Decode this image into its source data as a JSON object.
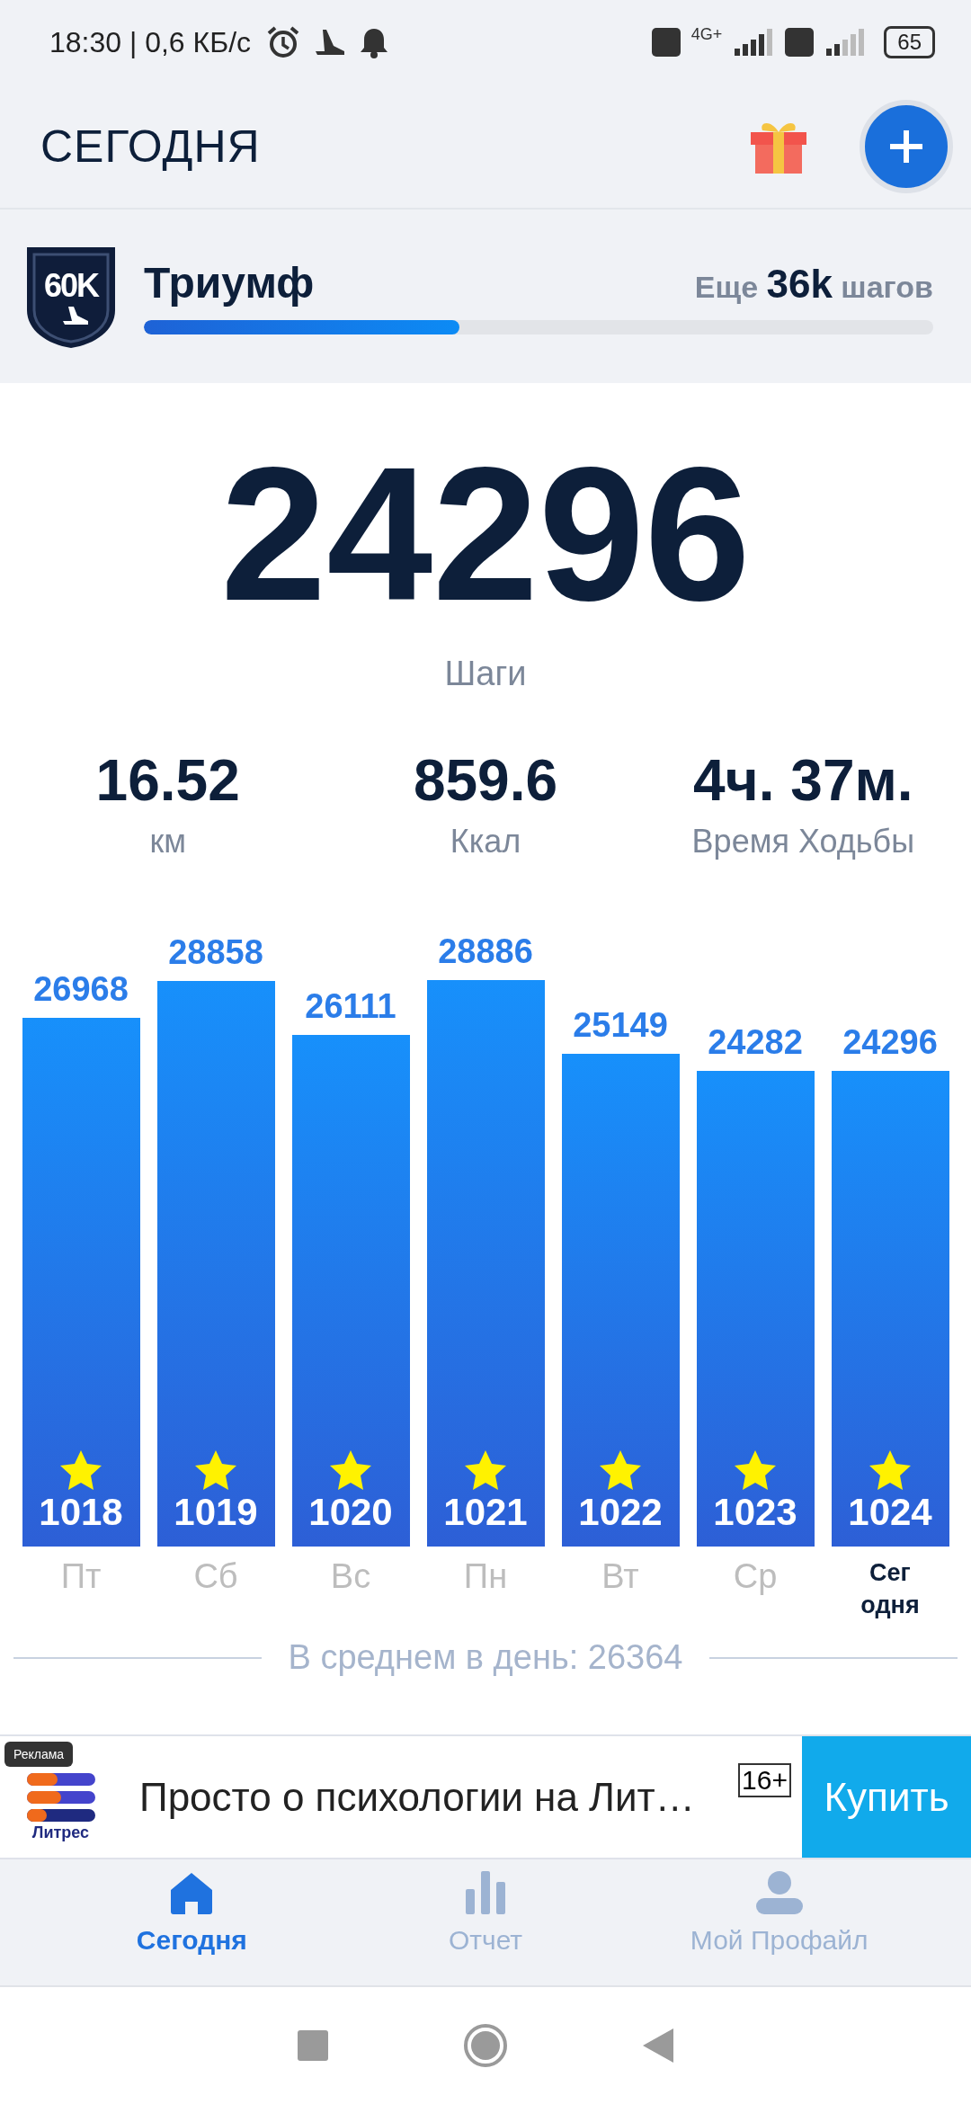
{
  "status_bar": {
    "time": "18:30 | 0,6 КБ/с",
    "network": "4G+",
    "battery": "65"
  },
  "header": {
    "title": "СЕГОДНЯ"
  },
  "goal": {
    "badge": "60K",
    "name": "Триумф",
    "remaining": "Еще **36k** шагов",
    "level": 0.4
  },
  "steps": {
    "value": "24296",
    "label": "Шаги"
  },
  "stats": [
    {
      "value": "16.52",
      "label": "км"
    },
    {
      "value": "859.6",
      "label": "Ккал"
    },
    {
      "value": "4ч. 37м.",
      "label": "Время Ходьбы"
    }
  ],
  "chart_data": {
    "type": "bar",
    "categories": [
      "Пт",
      "Сб",
      "Вс",
      "Пн",
      "Вт",
      "Ср",
      "Сег\nодня"
    ],
    "values": [
      26968,
      28858,
      26111,
      28886,
      25149,
      24282,
      24296
    ],
    "data_labels": true
  },
  "bar_marks": [
    {
      "count": "1018",
      "selected": false
    },
    {
      "count": "1019",
      "selected": false
    },
    {
      "count": "1020",
      "selected": false
    },
    {
      "count": "1021",
      "selected": false
    },
    {
      "count": "1022",
      "selected": false
    },
    {
      "count": "1023",
      "selected": false
    },
    {
      "count": "1024",
      "selected": true
    }
  ],
  "average": "В среднем в день: 26364",
  "ad": {
    "tag": "Реклама",
    "brand": "Литрес",
    "text": "Просто о психологии на Лит…",
    "age": "16+",
    "button": "Купить"
  },
  "nav": [
    {
      "label": "Сегодня",
      "selected": true,
      "kind": "home"
    },
    {
      "label": "Отчет",
      "selected": false,
      "kind": "report"
    },
    {
      "label": "Мой Профайл",
      "selected": false,
      "kind": "profile"
    }
  ]
}
